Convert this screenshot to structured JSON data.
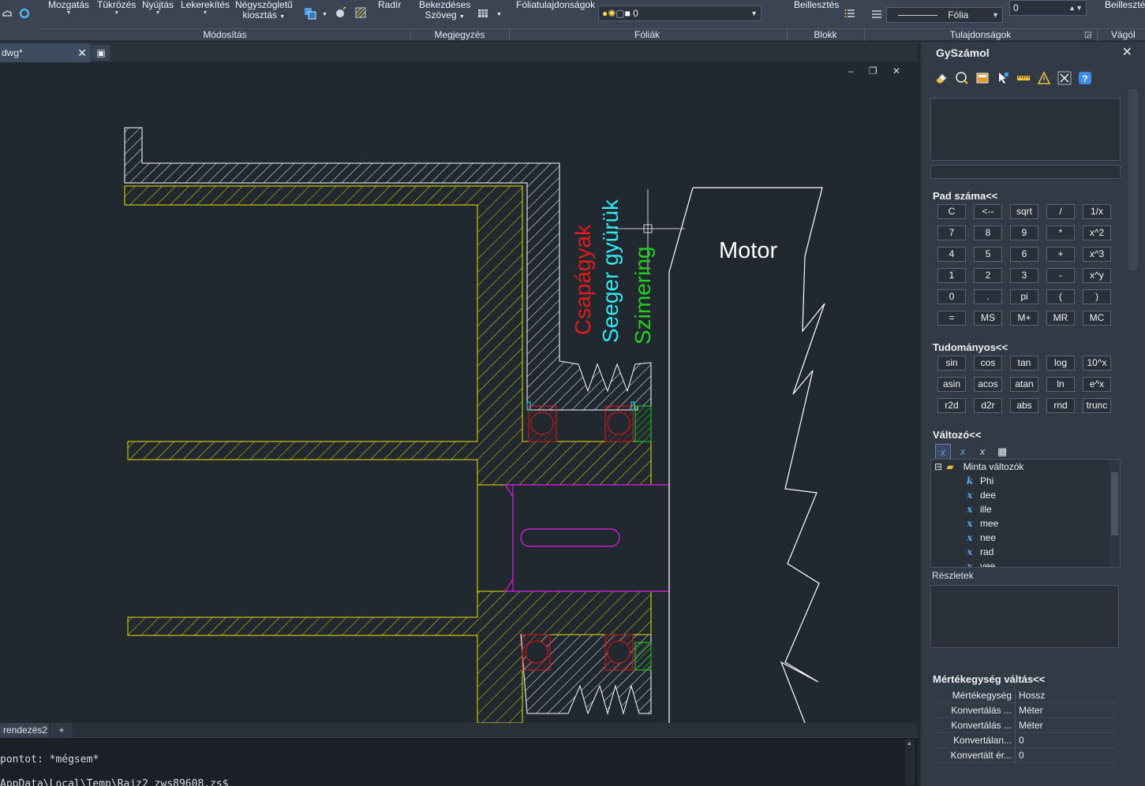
{
  "ribbon": {
    "buttons": {
      "mozgatas": "Mozgatás",
      "tukrozes": "Tükrözés",
      "nyujtas": "Nyújtás",
      "lekerekites": "Lekerekítés",
      "negyszogletu_line1": "Négyszögletű",
      "negyszogletu_line2": "kiosztás",
      "radir": "Radír",
      "bekezdeses_line1": "Bekezdéses",
      "bekezdeses_line2": "Szöveg",
      "foliatulajdonsagok": "Fóliatulajdonságok",
      "beillesztes": "Beillesztés",
      "beillesztes2": "Beillesztés"
    },
    "groups": {
      "modositas": "Módosítás",
      "megjegyzes": "Megjegyzés",
      "foliak": "Fóliák",
      "blokk": "Blokk",
      "tulajdonsagok": "Tulajdonságok",
      "vagolap": "Vágól"
    },
    "layer_combo_value": "0",
    "linetype_combo_value": "Fólia",
    "lineweight_value": "0"
  },
  "document": {
    "tab_title": "dwg*",
    "close_glyph": "✕",
    "new_tab_glyph": "▣",
    "window_controls": "‒ ❐ ✕"
  },
  "drawing": {
    "label_csapagyak": "Csapágyak",
    "label_seeger": "Seeger gyürük",
    "label_szimering": "Szimering",
    "label_motor": "Motor",
    "colors": {
      "housing": "#e6e600",
      "bearing": "#d41a1a",
      "seeger": "#33e6f0",
      "seal": "#22d022",
      "shaft": "#e020e0",
      "outline": "#ffffff"
    }
  },
  "layout_tabs": {
    "tab1": "rendezés2",
    "add": "+"
  },
  "command": {
    "line1": "pontot: *mégsem*",
    "line2": "AppData\\Local\\Temp\\Rajz2_zws89608.zs$"
  },
  "panel": {
    "title": "GySzámol",
    "close_glyph": "✕",
    "pad_title": "Pad száma<<",
    "pad_keys": [
      [
        "C",
        "<--",
        "sqrt",
        "/",
        "1/x"
      ],
      [
        "7",
        "8",
        "9",
        "*",
        "x^2"
      ],
      [
        "4",
        "5",
        "6",
        "+",
        "x^3"
      ],
      [
        "1",
        "2",
        "3",
        "-",
        "x^y"
      ],
      [
        "0",
        ".",
        "pi",
        "(",
        ")"
      ],
      [
        "=",
        "MS",
        "M+",
        "MR",
        "MC"
      ]
    ],
    "sci_title": "Tudományos<<",
    "sci_keys": [
      [
        "sin",
        "cos",
        "tan",
        "log",
        "10^x"
      ],
      [
        "asin",
        "acos",
        "atan",
        "ln",
        "e^x"
      ],
      [
        "r2d",
        "d2r",
        "abs",
        "rnd",
        "trunc"
      ]
    ],
    "var_title": "Változó<<",
    "var_root": "Minta változók",
    "variables": [
      {
        "icon": "k",
        "name": "Phi"
      },
      {
        "icon": "x",
        "name": "dee"
      },
      {
        "icon": "x",
        "name": "ille"
      },
      {
        "icon": "x",
        "name": "mee"
      },
      {
        "icon": "x",
        "name": "nee"
      },
      {
        "icon": "x",
        "name": "rad"
      },
      {
        "icon": "x",
        "name": "vee"
      }
    ],
    "details_label": "Részletek",
    "unit_title": "Mértékegység váltás<<",
    "unit_rows": [
      {
        "key": "Mértékegység",
        "value": "Hossz"
      },
      {
        "key": "Konvertálás ...",
        "value": "Méter"
      },
      {
        "key": "Konvertálás ...",
        "value": "Méter"
      },
      {
        "key": "Konvertálan...",
        "value": "0"
      },
      {
        "key": "Konvertált ér...",
        "value": "0"
      }
    ]
  }
}
